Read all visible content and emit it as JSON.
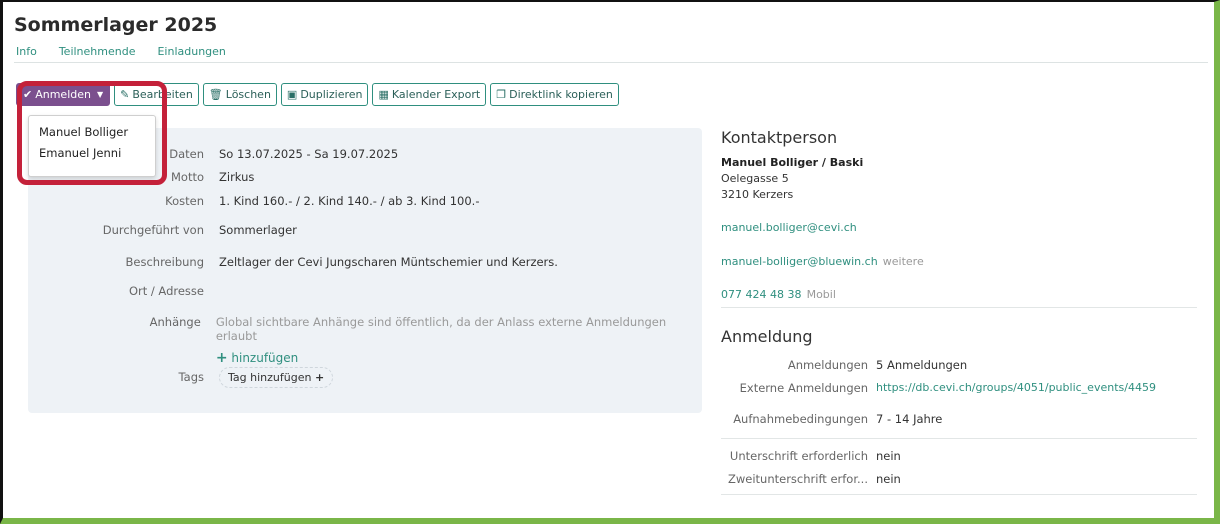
{
  "header": {
    "title": "Sommerlager 2025"
  },
  "tabs": [
    {
      "label": "Info"
    },
    {
      "label": "Teilnehmende"
    },
    {
      "label": "Einladungen"
    }
  ],
  "toolbar": {
    "register_label": "Anmelden",
    "edit_label": "Bearbeiten",
    "delete_label": "Löschen",
    "duplicate_label": "Duplizieren",
    "calendar_label": "Kalender Export",
    "copylink_label": "Direktlink kopieren"
  },
  "dropdown": {
    "items": [
      "Manuel Bolliger",
      "Emanuel Jenni"
    ]
  },
  "info": {
    "dates_label": "Daten",
    "dates_value": "So 13.07.2025 - Sa 19.07.2025",
    "motto_label": "Motto",
    "motto_value": "Zirkus",
    "cost_label": "Kosten",
    "cost_value": "1. Kind 160.- / 2. Kind 140.- / ab 3. Kind 100.-",
    "organizer_label": "Durchgeführt von",
    "organizer_value": "Sommerlager",
    "description_label": "Beschreibung",
    "description_value": "Zeltlager der Cevi Jungscharen Müntschemier und Kerzers.",
    "location_label": "Ort / Adresse",
    "attachments_label": "Anhänge",
    "attachments_hint": "Global sichtbare Anhänge sind öffentlich, da der Anlass externe Anmeldungen erlaubt",
    "attachments_add": "hinzufügen",
    "tags_label": "Tags",
    "tags_add": "Tag hinzufügen"
  },
  "contact": {
    "heading": "Kontaktperson",
    "name": "Manuel Bolliger / Baski",
    "street": "Oelegasse 5",
    "city": "3210 Kerzers",
    "email1": "manuel.bolliger@cevi.ch",
    "email2": "manuel-bolliger@bluewin.ch",
    "email2_more": "weitere",
    "phone": "077 424 48 38",
    "phone_type": "Mobil"
  },
  "registration": {
    "heading": "Anmeldung",
    "count_label": "Anmeldungen",
    "count_value": "5 Anmeldungen",
    "external_label": "Externe Anmeldungen",
    "external_value": "https://db.cevi.ch/groups/4051/public_events/4459",
    "conditions_label": "Aufnahmebedingungen",
    "conditions_value": "7 - 14 Jahre",
    "signature_label": "Unterschrift erforderlich",
    "signature_value": "nein",
    "second_signature_label": "Zweitunterschrift erfor...",
    "second_signature_value": "nein"
  },
  "colors": {
    "accent": "#2f8f7f",
    "primary_button": "#7b4f8e",
    "highlight": "#c4213a",
    "frame": "#7ab648"
  }
}
